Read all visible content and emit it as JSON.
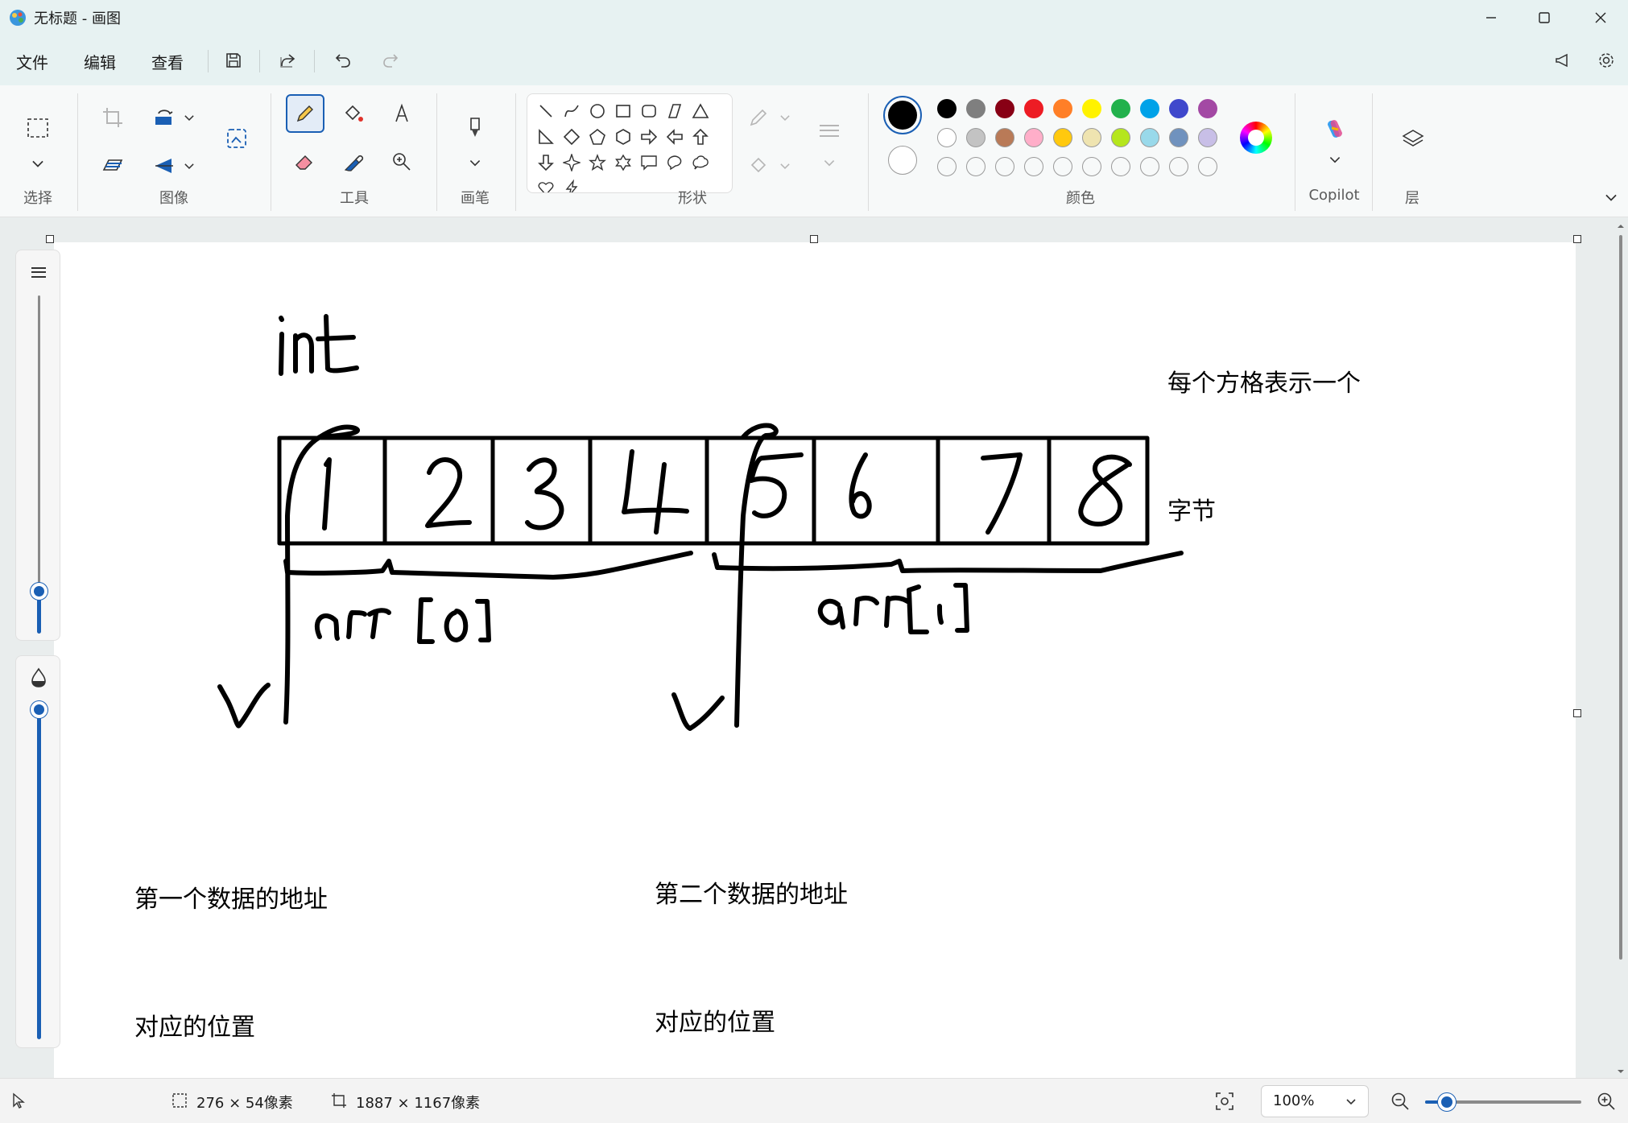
{
  "window": {
    "title": "无标题 - 画图"
  },
  "menu": {
    "file": "文件",
    "edit": "编辑",
    "view": "查看"
  },
  "ribbon": {
    "groups": {
      "select": "选择",
      "image": "图像",
      "tools": "工具",
      "brush": "画笔",
      "shapes": "形状",
      "colors": "颜色",
      "copilot": "Copilot",
      "layers": "层"
    }
  },
  "colors": {
    "row1": [
      "#000000",
      "#7f7f7f",
      "#880015",
      "#ed1c24",
      "#ff7f27",
      "#fff200",
      "#22b14c",
      "#00a2e8",
      "#3f48cc",
      "#a349a4"
    ],
    "row2": [
      "#ffffff",
      "#c3c3c3",
      "#b97a57",
      "#ffaec9",
      "#ffc90e",
      "#efe4b0",
      "#b5e61d",
      "#99d9ea",
      "#7092be",
      "#c8bfe7"
    ],
    "primary": "#000000",
    "secondary": "#ffffff",
    "accent": "#1a5fb4"
  },
  "canvas": {
    "handwritten": {
      "type_label": "int",
      "cells": [
        "1",
        "2",
        "3",
        "4",
        "5",
        "6",
        "7",
        "8"
      ],
      "brace_left": "arr[0]",
      "brace_right": "arr[1]"
    },
    "text_notes": {
      "cell_note_line1": "每个方格表示一个",
      "cell_note_line2": "字节",
      "first_addr_line1": "第一个数据的地址",
      "first_addr_line2": "对应的位置",
      "second_addr_line1": "第二个数据的地址",
      "second_addr_line2": "对应的位置"
    }
  },
  "status": {
    "selection_size": "276 × 54像素",
    "canvas_size": "1887 × 1167像素",
    "zoom": "100%",
    "zoom_slider_fraction": 0.14
  }
}
